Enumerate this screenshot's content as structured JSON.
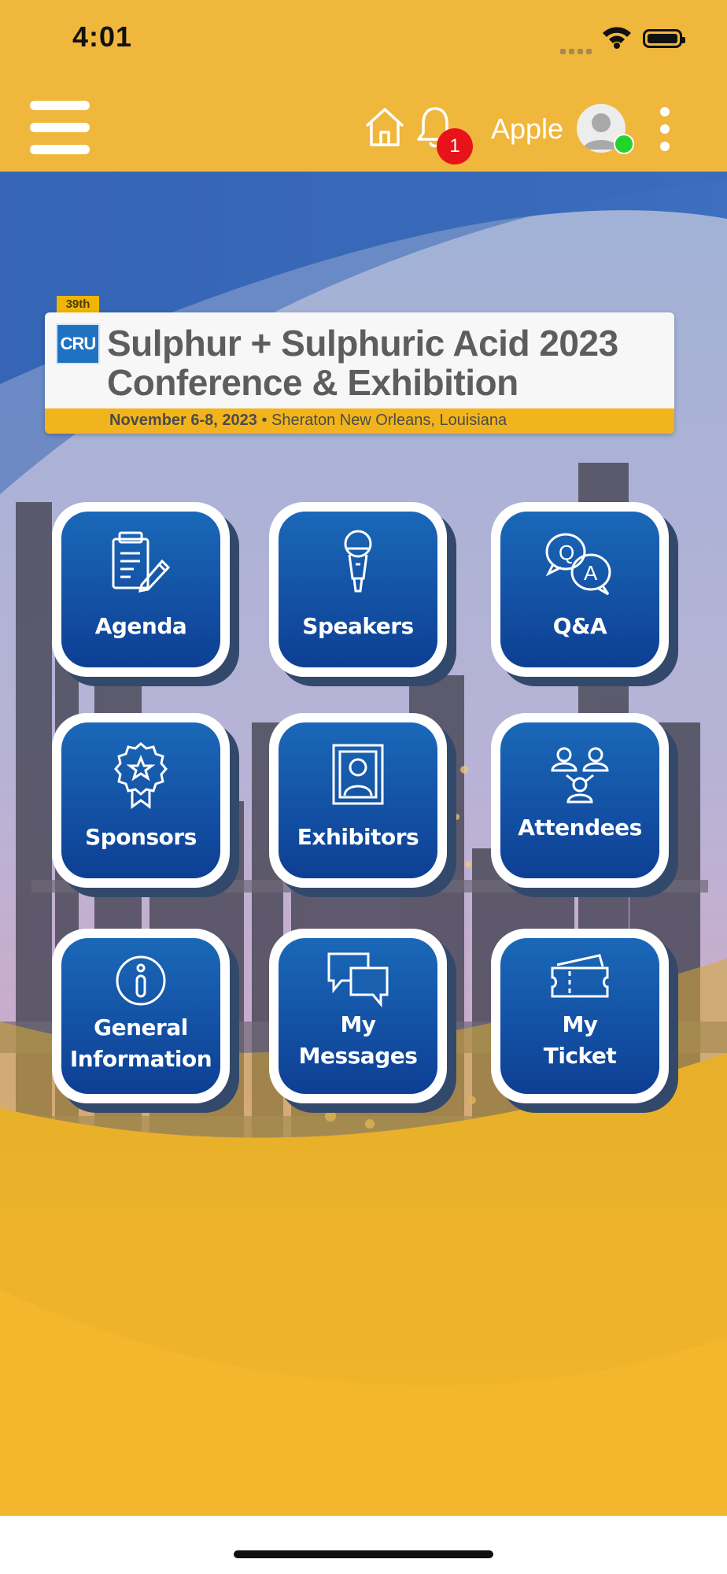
{
  "status_bar": {
    "time": "4:01"
  },
  "header": {
    "notification_count": "1",
    "user_name": "Apple",
    "user_online": true
  },
  "banner": {
    "edition": "39th",
    "logo_text": "CRU",
    "title_line1": "Sulphur + Sulphuric Acid 2023",
    "title_line2": "Conference & Exhibition",
    "date": "November 6-8, 2023",
    "separator": " • ",
    "venue": "Sheraton New Orleans, Louisiana"
  },
  "tiles": [
    {
      "label": "Agenda",
      "icon": "clipboard-icon"
    },
    {
      "label": "Speakers",
      "icon": "microphone-icon"
    },
    {
      "label": "Q&A",
      "icon": "qa-icon"
    },
    {
      "label": "Sponsors",
      "icon": "award-icon"
    },
    {
      "label": "Exhibitors",
      "icon": "portrait-icon"
    },
    {
      "label": "Attendees",
      "icon": "people-icon"
    },
    {
      "label_line1": "General",
      "label_line2": "Information",
      "icon": "info-icon"
    },
    {
      "label_line1": "My",
      "label_line2": "Messages",
      "icon": "messages-icon"
    },
    {
      "label_line1": "My",
      "label_line2": "Ticket",
      "icon": "ticket-icon"
    }
  ],
  "colors": {
    "header": "#f0b73d",
    "tile_top": "#1b68b8",
    "tile_bottom": "#0d3f94",
    "badge": "#e8121a",
    "online": "#22d32a"
  }
}
